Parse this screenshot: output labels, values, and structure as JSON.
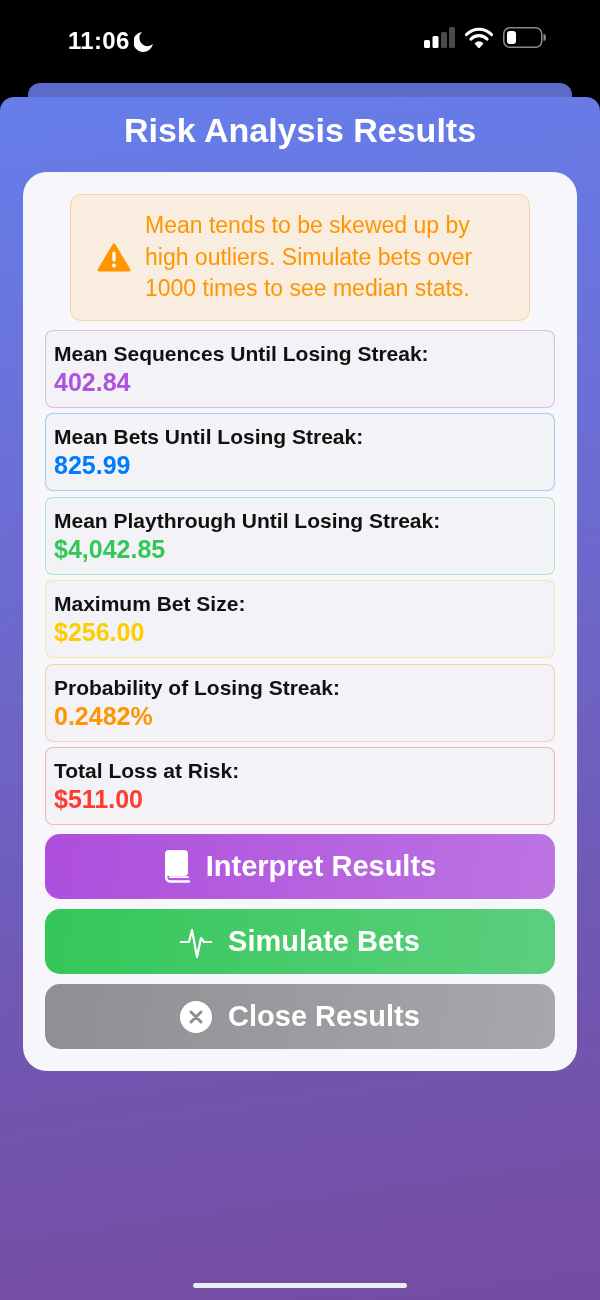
{
  "status_bar": {
    "time": "11:06"
  },
  "title": "Risk Analysis Results",
  "warning": {
    "text": "Mean tends to be skewed up by high outliers. Simulate bets over 1000 times to see median stats."
  },
  "stats": [
    {
      "label": "Mean Sequences Until Losing Streak:",
      "value": "402.84",
      "color": "#af52de"
    },
    {
      "label": "Mean Bets Until Losing Streak:",
      "value": "825.99",
      "color": "#007aff"
    },
    {
      "label": "Mean Playthrough Until Losing Streak:",
      "value": "$4,042.85",
      "color": "#34c759"
    },
    {
      "label": "Maximum Bet Size:",
      "value": "$256.00",
      "color": "#ffcc00"
    },
    {
      "label": "Probability of Losing Streak:",
      "value": "0.2482%",
      "color": "#ff9500"
    },
    {
      "label": "Total Loss at Risk:",
      "value": "$511.00",
      "color": "#ff3b30"
    }
  ],
  "buttons": [
    {
      "label": "Interpret Results",
      "kind": "interpret"
    },
    {
      "label": "Simulate Bets",
      "kind": "simulate"
    },
    {
      "label": "Close Results",
      "kind": "close"
    }
  ]
}
